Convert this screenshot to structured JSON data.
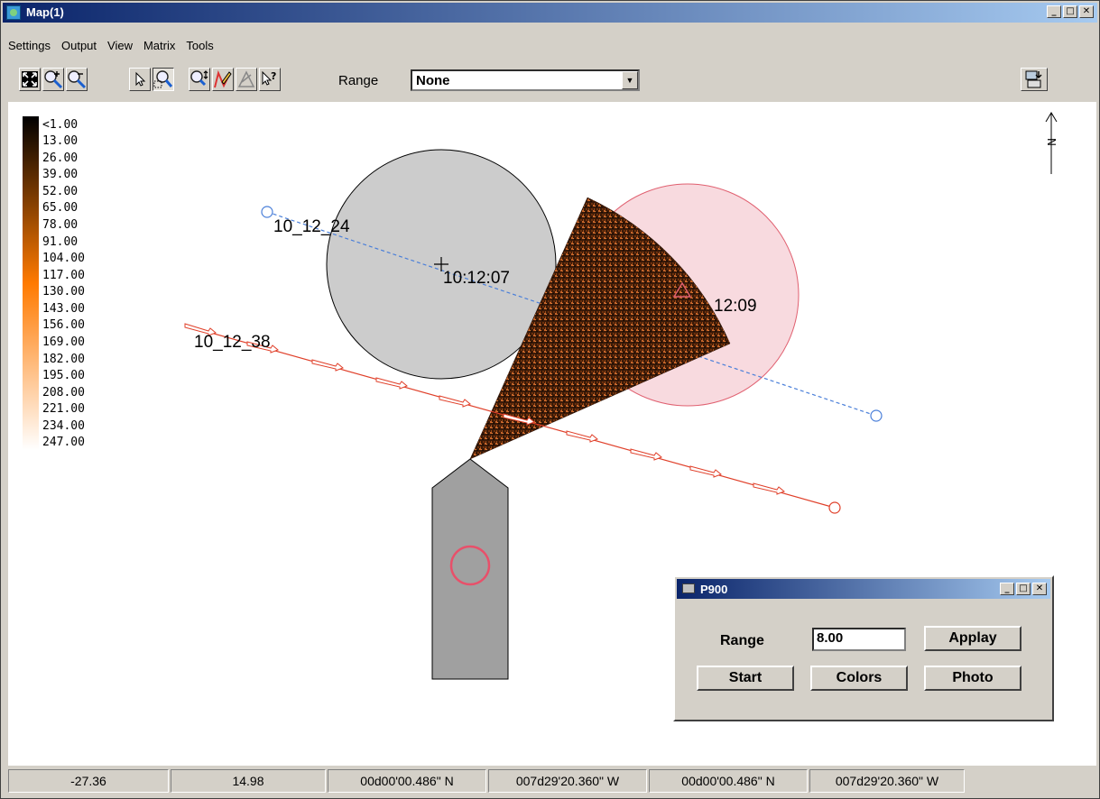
{
  "window": {
    "title": "Map(1)"
  },
  "window_controls": {
    "minimize": "_",
    "maximize": "□",
    "close": "✕"
  },
  "menu": {
    "items": [
      "Settings",
      "Output",
      "View",
      "Matrix",
      "Tools"
    ]
  },
  "toolbar": {
    "range_label": "Range",
    "range_value": "None",
    "tools": [
      "zoom-extent-icon",
      "zoom-in-icon",
      "zoom-out-icon",
      "pointer-icon",
      "zoom-window-icon",
      "pan-zoom-icon",
      "draw-icon",
      "measure-icon",
      "query-icon"
    ],
    "right_tool": "export-icon"
  },
  "legend": {
    "labels": [
      "<1.00",
      "13.00",
      "26.00",
      "39.00",
      "52.00",
      "65.00",
      "78.00",
      "91.00",
      "104.00",
      "117.00",
      "130.00",
      "143.00",
      "156.00",
      "169.00",
      "182.00",
      "195.00",
      "208.00",
      "221.00",
      "234.00",
      "247.00"
    ],
    "colors": {
      "low": "#000000",
      "mid": "#ff7a00",
      "high": "#ffffff"
    }
  },
  "map": {
    "north_label": "N",
    "labels": {
      "track_blue_start": "10_12_24",
      "grey_target_time": "10:12:07",
      "pink_target_time": "12:09",
      "track_red_start": "10_12_38"
    },
    "colors": {
      "grey_target": "#cccccc",
      "pink_target": "#f8dadf",
      "pink_outline": "#e06070",
      "blue_track": "#4a7fd9",
      "red_track": "#e0402a",
      "vessel": "#a0a0a0"
    }
  },
  "dialog": {
    "title": "P900",
    "range_label": "Range",
    "range_value": "8.00",
    "buttons": {
      "apply": "Applay",
      "start": "Start",
      "colors": "Colors",
      "photo": "Photo"
    }
  },
  "status": {
    "cells": [
      "-27.36",
      "14.98",
      "00d00'00.486\" N",
      "007d29'20.360\" W",
      "00d00'00.486\" N",
      "007d29'20.360\" W"
    ]
  }
}
